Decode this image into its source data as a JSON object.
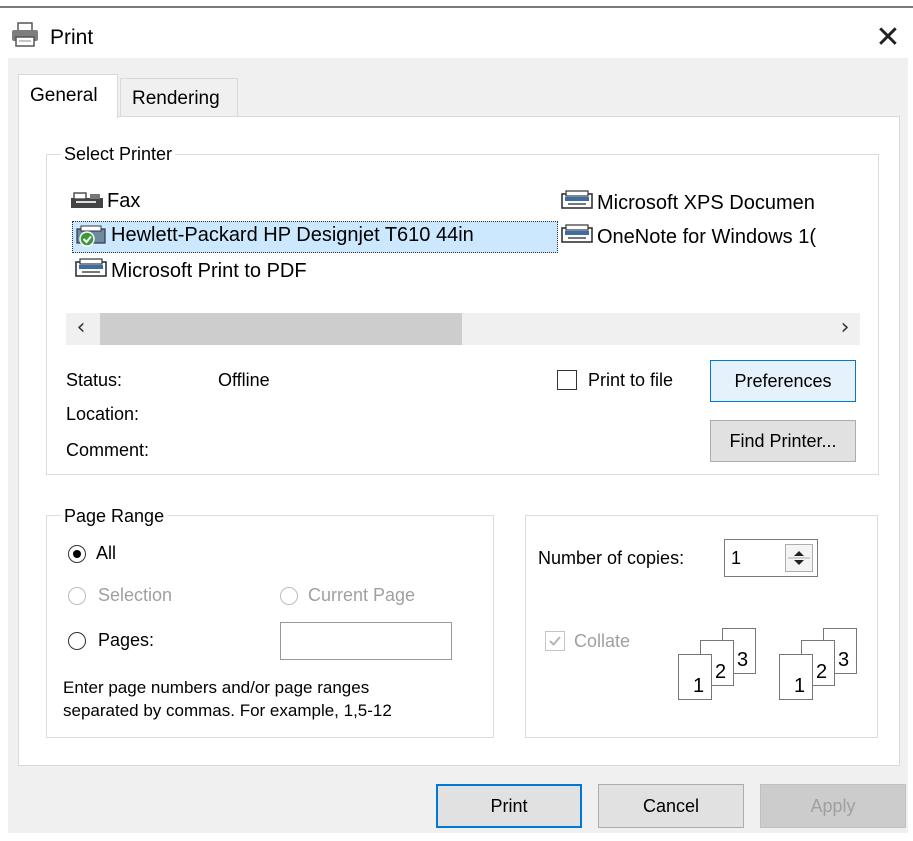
{
  "window": {
    "title": "Print",
    "close_symbol": "✕"
  },
  "tabs": [
    {
      "label": "General"
    },
    {
      "label": "Rendering"
    }
  ],
  "select_printer": {
    "legend": "Select Printer",
    "printers": [
      {
        "name": "Fax",
        "icon": "fax-icon"
      },
      {
        "name": "Hewlett-Packard HP Designjet T610 44in",
        "icon": "printer-default-icon",
        "selected": true
      },
      {
        "name": "Microsoft Print to PDF",
        "icon": "printer-icon"
      },
      {
        "name": "Microsoft XPS Documen",
        "icon": "printer-icon"
      },
      {
        "name": "OneNote for Windows 1(",
        "icon": "printer-icon"
      }
    ],
    "scroll_left": "‹",
    "scroll_right": "›",
    "status_label": "Status:",
    "status_value": "Offline",
    "location_label": "Location:",
    "comment_label": "Comment:",
    "print_to_file_label": "Print to file",
    "print_to_file_checked": false,
    "preferences_label": "Preferences",
    "find_printer_label": "Find Printer..."
  },
  "page_range": {
    "legend": "Page Range",
    "all_label": "All",
    "selection_label": "Selection",
    "current_page_label": "Current Page",
    "pages_label": "Pages:",
    "pages_value": "",
    "hint_line1": "Enter page numbers and/or page ranges",
    "hint_line2": "separated by commas.  For example, 1,5-12",
    "selected_option": "All"
  },
  "copies": {
    "label": "Number of copies:",
    "value": "1",
    "collate_label": "Collate",
    "collate_checked": true,
    "sheets": [
      "1",
      "2",
      "3"
    ]
  },
  "footer": {
    "print_label": "Print",
    "cancel_label": "Cancel",
    "apply_label": "Apply"
  },
  "colors": {
    "accent": "#0078d7",
    "selection": "#cce8ff",
    "disabled_text": "#a0a0a0"
  }
}
